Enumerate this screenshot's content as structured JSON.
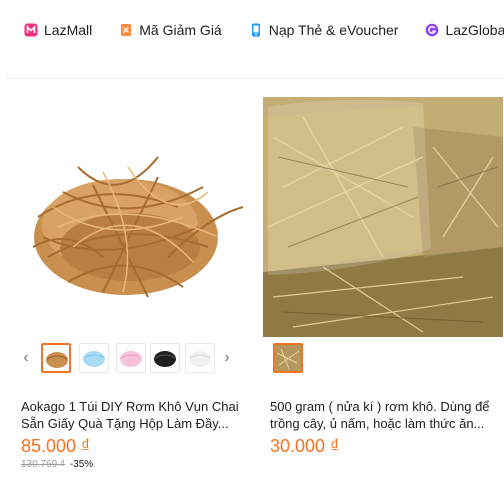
{
  "nav": {
    "items": [
      {
        "label": "LazMall",
        "icon": "lazmall-icon",
        "color": "#e8247a"
      },
      {
        "label": "Mã Giảm Giá",
        "icon": "voucher-icon",
        "color": "#f57224"
      },
      {
        "label": "Nạp Thẻ & eVoucher",
        "icon": "phone-topup-icon",
        "color": "#1a9cff"
      },
      {
        "label": "LazGlobal",
        "icon": "globe-icon",
        "color": "#8a3ffc"
      }
    ]
  },
  "products": [
    {
      "title": "Aokago 1 Túi DIY Rơm Khô Vụn Chai Sẵn Giấy Quà Tặng Hộp Làm Đầy...",
      "price": "85.000 ₫",
      "original_price": "130.769 ₫",
      "discount": "-35%",
      "swatches": [
        "brown",
        "blue",
        "pink",
        "black",
        "white"
      ],
      "selected_swatch": 0
    },
    {
      "title": "500 gram ( nửa kí ) rơm khô. Dùng để trồng cây, ủ nấm, hoặc làm thức ăn...",
      "price": "30.000 ₫",
      "swatches": [
        "hay"
      ],
      "selected_swatch": 0
    }
  ],
  "colors": {
    "price": "#f57224",
    "selected_border": "#f57224"
  }
}
